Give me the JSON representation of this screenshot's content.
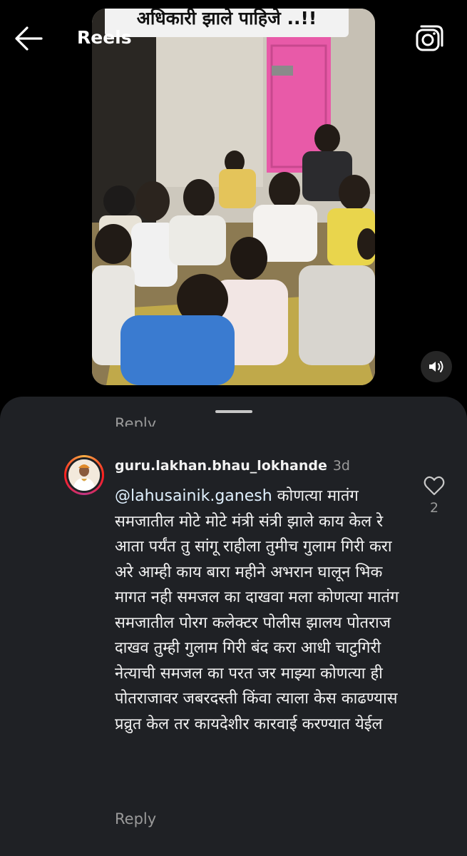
{
  "header": {
    "title": "Reels",
    "back_icon": "arrow-left-icon",
    "camera_icon": "camera-icon"
  },
  "reel": {
    "caption": "अधिकारी झाले पाहिजे ..!!",
    "mute_icon": "speaker-icon"
  },
  "comments_sheet": {
    "previous_reply_label": "Reply",
    "comment": {
      "username": "guru.lakhan.bhau_lokhande",
      "age": "3d",
      "mention": "@lahusainik.ganesh",
      "text": " कोणत्या मातंग समजातील मोटे मोटे मंत्री संत्री झाले काय केल रे आता पर्यंत तु सांगू राहीला तुमीच गुलाम गिरी करा अरे  आम्ही काय बारा महीने अभरान घालून भिक मागत नही समजल का दाखवा मला कोणत्या मातंग समजातील पोरग कलेक्टर पोलीस झालय पोतराज दाखव तुम्ही गुलाम गिरी बंद करा आधी चाटुगिरी नेत्याची समजल का परत जर माझ्या कोणत्या ही पोतराजावर जबरदस्ती किंवा त्याला केस काढण्यास प्रव्रुत केल तर कायदेशीर कारवाई करण्यात येईल",
      "reply_label": "Reply",
      "like_count": "2",
      "like_icon": "heart-outline-icon"
    }
  },
  "colors": {
    "background": "#000000",
    "sheet": "#1f2125",
    "secondary_text": "#9a9a9a",
    "door_pink": "#e85aa8"
  }
}
